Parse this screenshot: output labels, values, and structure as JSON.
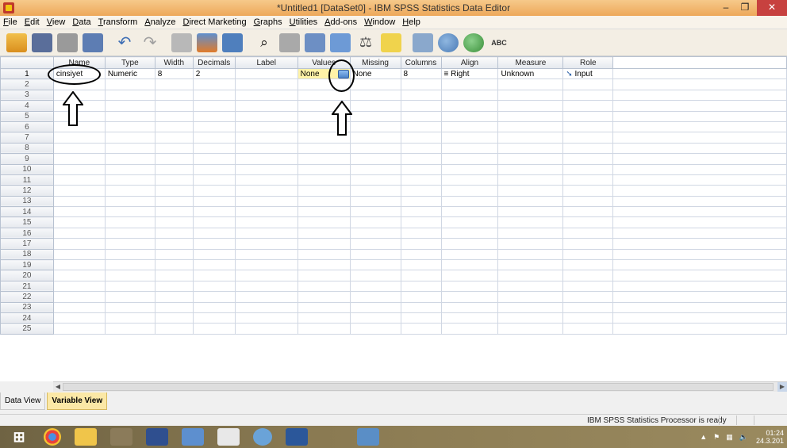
{
  "window": {
    "title": "*Untitled1 [DataSet0] - IBM SPSS Statistics Data Editor",
    "minimize": "–",
    "maximize": "❐",
    "close": "✕"
  },
  "menu": [
    "File",
    "Edit",
    "View",
    "Data",
    "Transform",
    "Analyze",
    "Direct Marketing",
    "Graphs",
    "Utilities",
    "Add-ons",
    "Window",
    "Help"
  ],
  "toolbar": {
    "icons": [
      "open-icon",
      "save-icon",
      "print-icon",
      "dialog-recall-icon",
      "undo-icon",
      "redo-icon",
      "goto-case-icon",
      "goto-variable-icon",
      "variables-icon",
      "find-icon",
      "insert-cases-icon",
      "insert-variable-icon",
      "split-file-icon",
      "weight-cases-icon",
      "select-cases-icon",
      "value-labels-icon",
      "use-sets-icon",
      "show-all-variables-icon",
      "spell-check-icon"
    ],
    "spell_label": "ABC"
  },
  "grid": {
    "columns": [
      "Name",
      "Type",
      "Width",
      "Decimals",
      "Label",
      "Values",
      "Missing",
      "Columns",
      "Align",
      "Measure",
      "Role"
    ],
    "rows": [
      {
        "num": "1",
        "name": "cinsiyet",
        "type": "Numeric",
        "width": "8",
        "decimals": "2",
        "label": "",
        "values": "None",
        "missing": "None",
        "columns": "8",
        "align": "Right",
        "measure": "Unknown",
        "role": "Input"
      }
    ],
    "empty_row_numbers": [
      "2",
      "3",
      "4",
      "5",
      "6",
      "7",
      "8",
      "9",
      "10",
      "11",
      "12",
      "13",
      "14",
      "15",
      "16",
      "17",
      "18",
      "19",
      "20",
      "21",
      "22",
      "23",
      "24",
      "25"
    ]
  },
  "tabs": {
    "data_view": "Data View",
    "variable_view": "Variable View",
    "active": "Variable View"
  },
  "status": {
    "message": "IBM SPSS Statistics Processor is ready"
  },
  "taskbar": {
    "apps": [
      "start-icon",
      "chrome-icon",
      "file-explorer-icon",
      "people-icon",
      "pspp-icon",
      "monitor-icon",
      "yandex-icon",
      "sigma-icon",
      "word-icon",
      "paint-icon",
      "spss-icon"
    ],
    "time": "01:24",
    "date": "24.3.201"
  },
  "colors": {
    "titlebar": "#eda85a",
    "selected_cell": "#fff3a8",
    "active_tab": "#fbe8a6",
    "taskbar": "#8a7a52"
  }
}
